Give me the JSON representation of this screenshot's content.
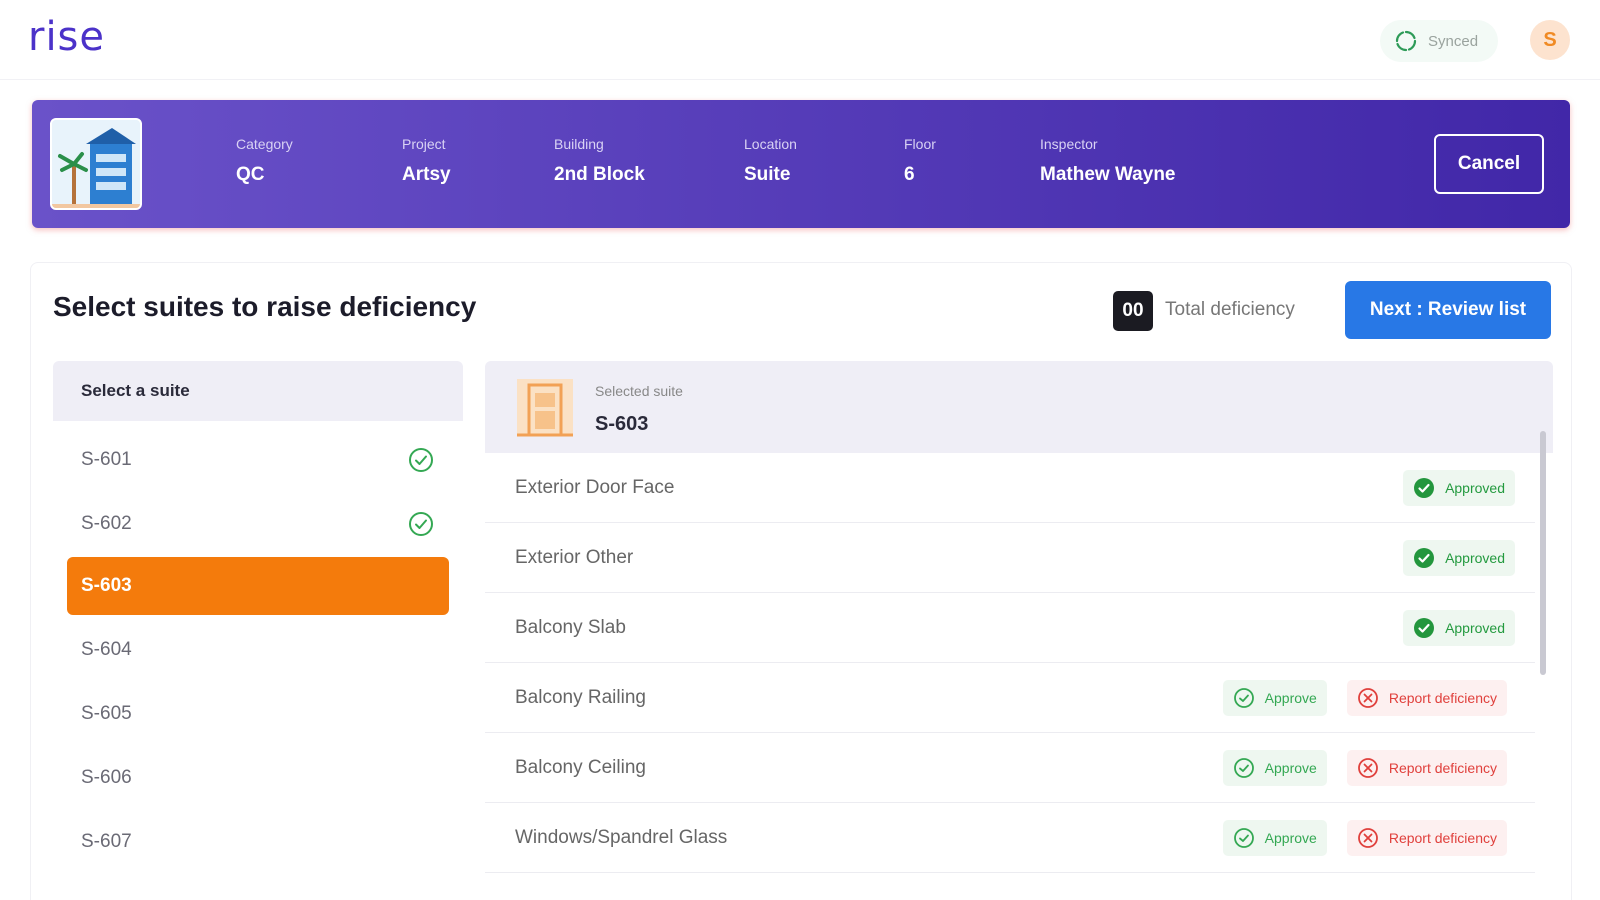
{
  "app": {
    "logo": "rise",
    "sync_status": "Synced",
    "user_initial": "S"
  },
  "banner": {
    "fields": [
      {
        "label": "Category",
        "value": "QC"
      },
      {
        "label": "Project",
        "value": "Artsy"
      },
      {
        "label": "Building",
        "value": "2nd Block"
      },
      {
        "label": "Location",
        "value": "Suite"
      },
      {
        "label": "Floor",
        "value": "6"
      },
      {
        "label": "Inspector",
        "value": "Mathew Wayne"
      }
    ],
    "cancel_label": "Cancel"
  },
  "main": {
    "title": "Select suites to raise deficiency",
    "deficiency_count": "00",
    "deficiency_label": "Total deficiency",
    "next_label": "Next : Review list"
  },
  "suites": {
    "header": "Select a suite",
    "items": [
      {
        "label": "S-601",
        "done": true
      },
      {
        "label": "S-602",
        "done": true
      },
      {
        "label": "S-603",
        "done": false,
        "active": true
      },
      {
        "label": "S-604",
        "done": false
      },
      {
        "label": "S-605",
        "done": false
      },
      {
        "label": "S-606",
        "done": false
      },
      {
        "label": "S-607",
        "done": false
      }
    ]
  },
  "detail": {
    "selected_label": "Selected suite",
    "selected_value": "S-603",
    "approved_label": "Approved",
    "approve_label": "Approve",
    "report_label": "Report deficiency",
    "rows": [
      {
        "label": "Exterior Door Face",
        "status": "approved"
      },
      {
        "label": "Exterior Other",
        "status": "approved"
      },
      {
        "label": "Balcony Slab",
        "status": "approved"
      },
      {
        "label": "Balcony Railing",
        "status": "pending"
      },
      {
        "label": "Balcony Ceiling",
        "status": "pending"
      },
      {
        "label": "Windows/Spandrel Glass",
        "status": "pending"
      }
    ]
  },
  "colors": {
    "brand": "#4b32c9",
    "active_suite": "#f47b0c",
    "primary_button": "#2878e6",
    "approved": "#239a3f",
    "report": "#e0403c"
  }
}
